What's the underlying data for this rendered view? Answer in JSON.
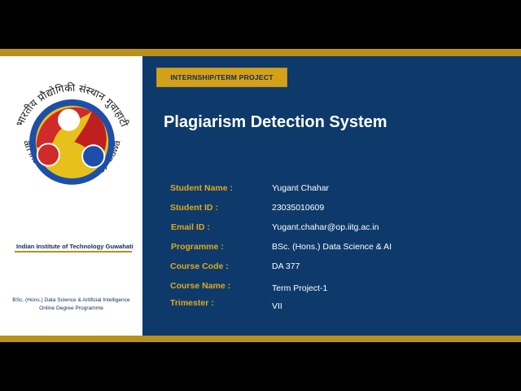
{
  "institute": {
    "logo_text": "भारतीय प्रौद्योगिकी संस्थान गुवाहाटी",
    "logo_text_en": "Indian Institute of Technology Guwahati",
    "name": "Indian Institute of Technology Guwahati",
    "programme_line1": "BSc. (Hons.) Data Science & Artificial Intelligence",
    "programme_line2": "Online Degree Programme"
  },
  "tag": "INTERNSHIP/TERM PROJECT",
  "title": "Plagiarism Detection System",
  "details": [
    {
      "label": "Student Name :",
      "value": "Yugant Chahar"
    },
    {
      "label": "Student ID :",
      "value": "23035010609"
    },
    {
      "label": "Email ID :",
      "value": "Yugant.chahar@op.iitg.ac.in"
    },
    {
      "label": "Programme :",
      "value": "BSc. (Hons.) Data Science & AI"
    },
    {
      "label": "Course Code :",
      "value": "DA 377"
    },
    {
      "label": "Course Name :",
      "value": "Term Project-1"
    },
    {
      "label": "Trimester :",
      "value": "VII"
    }
  ],
  "colors": {
    "navy": "#0e3a6b",
    "gold": "#b8901a",
    "label_gold": "#e0a91a"
  }
}
